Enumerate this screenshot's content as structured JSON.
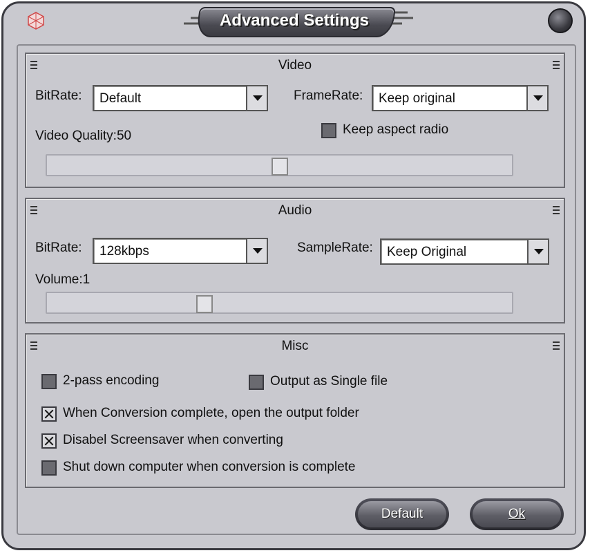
{
  "window": {
    "title": "Advanced Settings"
  },
  "video": {
    "title": "Video",
    "bitrate_label": "BitRate:",
    "bitrate_value": "Default",
    "framerate_label": "FrameRate:",
    "framerate_value": "Keep original",
    "quality_label": "Video Quality:50",
    "quality_value": 50,
    "keep_aspect_label": "Keep aspect radio",
    "keep_aspect_checked": false
  },
  "audio": {
    "title": "Audio",
    "bitrate_label": "BitRate:",
    "bitrate_value": "128kbps",
    "samplerate_label": "SampleRate:",
    "samplerate_value": "Keep Original",
    "volume_label": "Volume:1",
    "volume_value": 1
  },
  "misc": {
    "title": "Misc",
    "two_pass_label": "2-pass encoding",
    "two_pass_checked": false,
    "single_file_label": "Output as Single file",
    "single_file_checked": false,
    "open_folder_label": "When Conversion complete, open the output folder",
    "open_folder_checked": true,
    "disable_ss_label": "Disabel Screensaver when converting",
    "disable_ss_checked": true,
    "shutdown_label": "Shut down computer when conversion is complete",
    "shutdown_checked": false
  },
  "buttons": {
    "default_label": "Default",
    "ok_label": "Ok"
  }
}
